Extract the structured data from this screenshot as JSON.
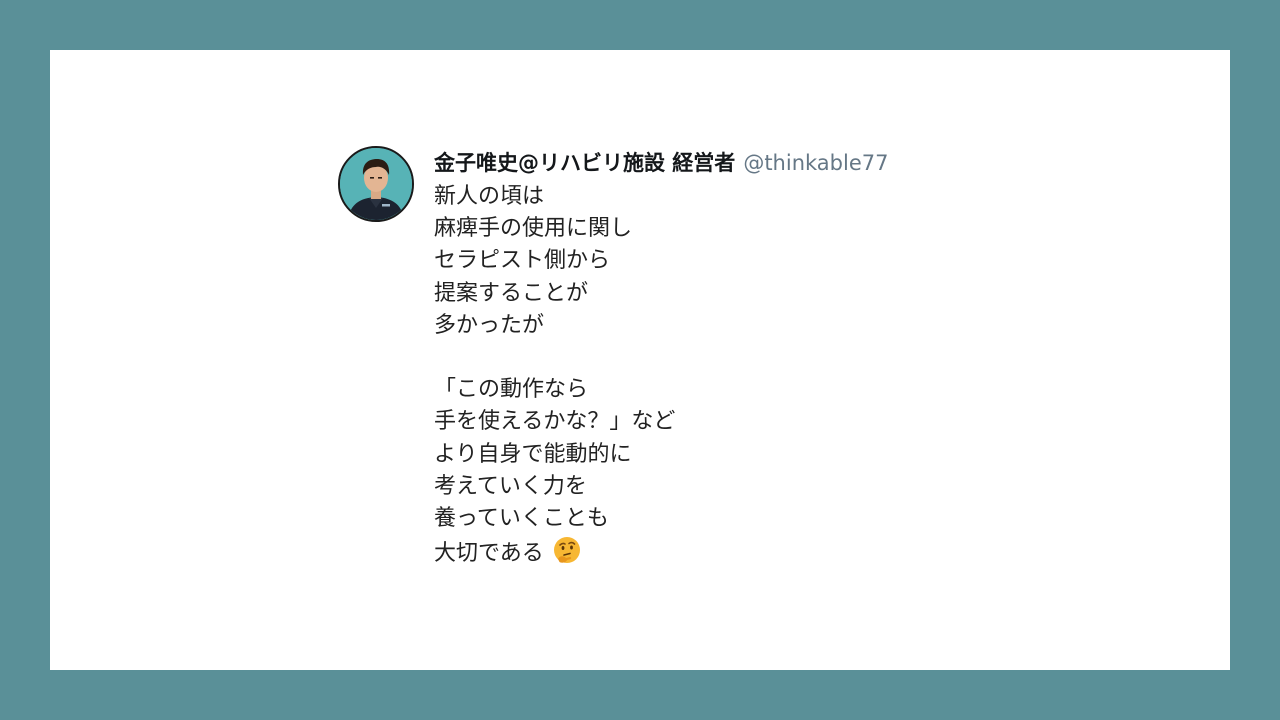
{
  "tweet": {
    "display_name": "金子唯史@リハビリ施設 経営者",
    "handle": "@thinkable77",
    "lines": [
      "新人の頃は",
      "麻痺手の使用に関し",
      "セラピスト側から",
      "提案することが",
      "多かったが",
      "",
      "「この動作なら",
      "手を使えるかな？」など",
      "より自身で能動的に",
      "考えていく力を",
      "養っていくことも",
      "大切である"
    ],
    "trailing_emoji": "thinking-face-icon"
  },
  "colors": {
    "background": "#5a9098",
    "card": "#ffffff",
    "name": "#14171a",
    "handle": "#657786",
    "text": "#222222",
    "avatar_bg": "#57b3b6"
  }
}
